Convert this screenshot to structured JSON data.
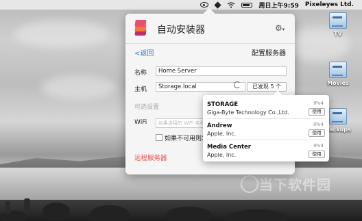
{
  "menubar": {
    "icons": [
      "eye-icon",
      "cube-icon",
      "wifi-icon",
      "battery-icon"
    ],
    "clock": "周日上午9:59",
    "user": "Pixeleyes Ltd."
  },
  "desktop_icons": [
    {
      "label": "TV",
      "icon": "network-drive-icon"
    },
    {
      "label": "Movies",
      "icon": "network-drive-icon"
    },
    {
      "label": "Backups",
      "icon": "network-drive-icon"
    }
  ],
  "panel": {
    "title": "自动安装器",
    "back_label": "返回",
    "nav_title": "配置服务器",
    "name_label": "名称",
    "name_value": "Home Server",
    "host_label": "主机",
    "host_value": "Storage.local",
    "found_button": "已发现 5 个",
    "optional_label": "可选设置",
    "wifi_label": "WiFi",
    "wifi_placeholder": "如果连接的 WiFi 名称相同",
    "fallback_label": "如果不可用则发",
    "remote_label": "远程服务器",
    "accent_color": "#e8484a",
    "link_color": "#2f7bd6"
  },
  "popup": {
    "rows": [
      {
        "name": "STORAGE",
        "vendor": "Giga-Byte Technology Co.,Ltd.",
        "ip": "IPv4",
        "button": "使用"
      },
      {
        "name": "Andrew",
        "vendor": "Apple, Inc.",
        "ip": "IPv4",
        "button": "使用"
      },
      {
        "name": "Media Center",
        "vendor": "Apple, Inc.",
        "ip": "IPv4",
        "button": "使用"
      }
    ]
  },
  "watermark": "当下软件园"
}
